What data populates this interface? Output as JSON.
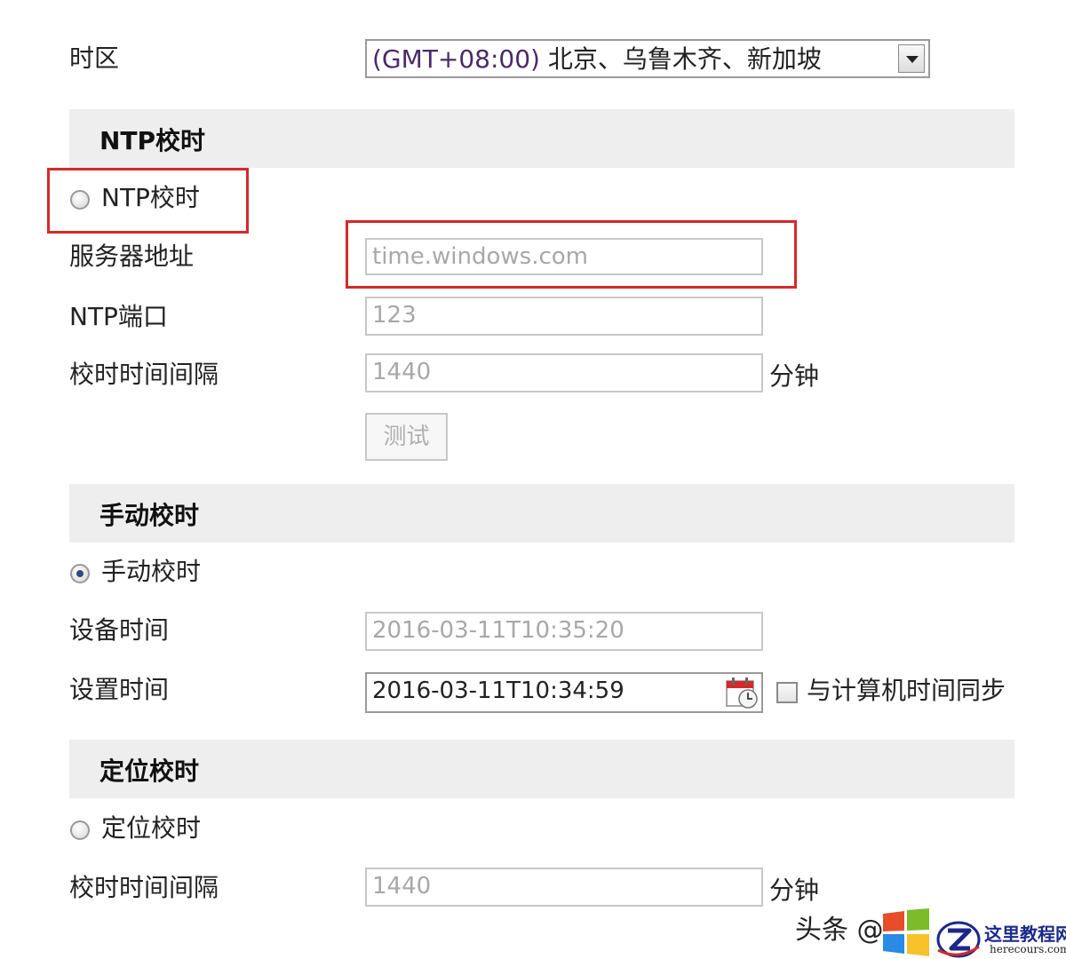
{
  "timezone": {
    "label": "时区",
    "value_gmt": "(GMT+08:00)",
    "value_cities": "北京、乌鲁木齐、新加坡"
  },
  "ntp_section": {
    "title": "NTP校时",
    "radio_label": "NTP校时",
    "server_label": "服务器地址",
    "server_value": "time.windows.com",
    "port_label": "NTP端口",
    "port_value": "123",
    "interval_label": "校时时间间隔",
    "interval_value": "1440",
    "interval_unit": "分钟",
    "test_button": "测试"
  },
  "manual_section": {
    "title": "手动校时",
    "radio_label": "手动校时",
    "device_time_label": "设备时间",
    "device_time_value": "2016-03-11T10:35:20",
    "set_time_label": "设置时间",
    "set_time_value": "2016-03-11T10:34:59",
    "sync_label": "与计算机时间同步"
  },
  "gps_section": {
    "title": "定位校时",
    "radio_label": "定位校时",
    "interval_label": "校时时间间隔",
    "interval_value": "1440",
    "interval_unit": "分钟"
  },
  "watermark": {
    "prefix": "头条 @",
    "brand_name": "这里教程网",
    "brand_url": "herecours.com"
  },
  "colors": {
    "highlight": "#d42a2a",
    "section_bg": "#eeeeee",
    "radio_dot": "#2a4a8a"
  }
}
